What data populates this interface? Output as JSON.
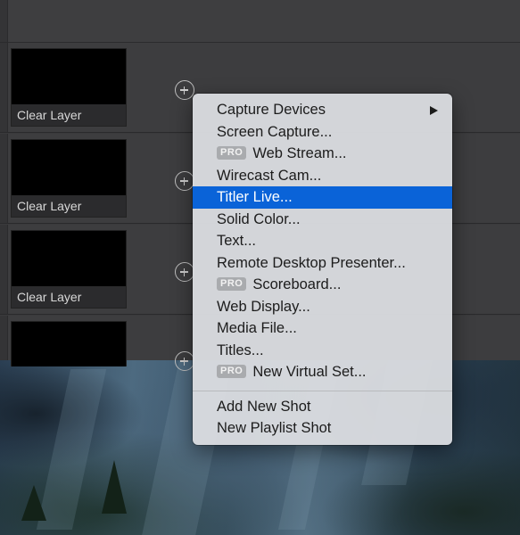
{
  "layers": [
    {
      "shot_label": "Clear Layer"
    },
    {
      "shot_label": "Clear Layer"
    },
    {
      "shot_label": "Clear Layer"
    },
    {
      "shot_label": ""
    }
  ],
  "menu": {
    "items": [
      {
        "label": "Capture Devices",
        "has_submenu": true
      },
      {
        "label": "Screen Capture..."
      },
      {
        "label": "Web Stream...",
        "badge": "PRO"
      },
      {
        "label": "Wirecast Cam..."
      },
      {
        "label": "Titler Live...",
        "highlighted": true
      },
      {
        "label": "Solid Color..."
      },
      {
        "label": "Text..."
      },
      {
        "label": "Remote Desktop Presenter..."
      },
      {
        "label": "Scoreboard...",
        "badge": "PRO"
      },
      {
        "label": "Web Display..."
      },
      {
        "label": "Media File..."
      },
      {
        "label": "Titles..."
      },
      {
        "label": "New Virtual Set...",
        "badge": "PRO"
      }
    ],
    "footer_items": [
      {
        "label": "Add New Shot"
      },
      {
        "label": "New Playlist Shot"
      }
    ]
  },
  "colors": {
    "highlight": "#0a63d8",
    "menu_bg": "#dadce0",
    "app_bg": "#3a3a3c"
  },
  "icons": {
    "add_shot": "plus-circle-icon",
    "submenu": "chevron-right-icon"
  }
}
